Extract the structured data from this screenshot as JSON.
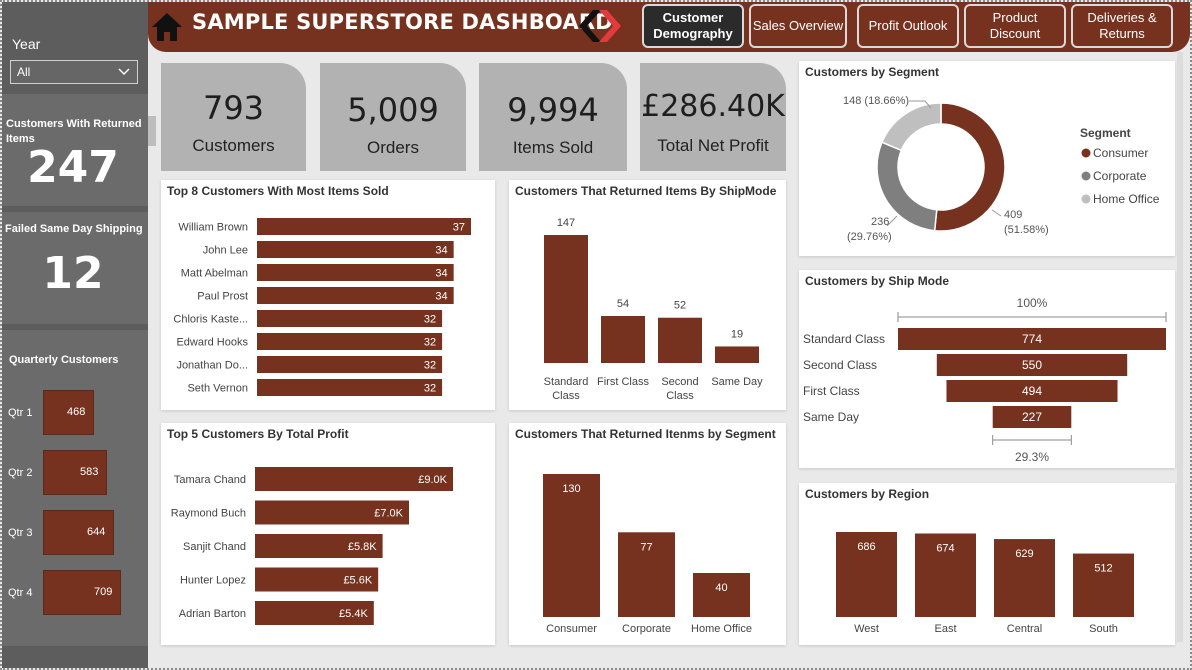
{
  "filters": {
    "year_label": "Year",
    "year_value": "All"
  },
  "side_kpis": {
    "returned_title": "Customers With Returned Items",
    "returned_value": "247",
    "failed_title": "Failed Same Day Shipping",
    "failed_value": "12"
  },
  "quarterly": {
    "title": "Quarterly Customers",
    "items": [
      {
        "label": "Qtr 1",
        "value": 468
      },
      {
        "label": "Qtr 2",
        "value": 583
      },
      {
        "label": "Qtr 3",
        "value": 644
      },
      {
        "label": "Qtr 4",
        "value": 709
      }
    ]
  },
  "header": {
    "title": "SAMPLE SUPERSTORE DASHBOARD",
    "nav": [
      {
        "label": "Customer Demography",
        "active": true
      },
      {
        "label": "Sales Overview",
        "active": false
      },
      {
        "label": "Profit Outlook",
        "active": false
      },
      {
        "label": "Product Discount",
        "active": false
      },
      {
        "label": "Deliveries & Returns",
        "active": false
      }
    ]
  },
  "kpis": [
    {
      "value": "793",
      "label": "Customers"
    },
    {
      "value": "5,009",
      "label": "Orders"
    },
    {
      "value": "9,994",
      "label": "Items Sold"
    },
    {
      "value": "£286.40K",
      "label": "Total Net Profit"
    }
  ],
  "colors": {
    "accent": "#76321f",
    "grey": "#b2b2b2",
    "sidebar": "#5d5d5d",
    "donut_corporate": "#7f7f7f",
    "donut_home": "#bfbfbf"
  },
  "chart_data": [
    {
      "id": "top8",
      "type": "bar",
      "orientation": "horizontal",
      "title": "Top 8 Customers With Most Items Sold",
      "categories": [
        "William Brown",
        "John Lee",
        "Matt Abelman",
        "Paul Prost",
        "Chloris Kaste...",
        "Edward Hooks",
        "Jonathan Do...",
        "Seth Vernon"
      ],
      "values": [
        37,
        34,
        34,
        34,
        32,
        32,
        32,
        32
      ]
    },
    {
      "id": "returned_shipmode",
      "type": "bar",
      "title": "Customers That Returned Items By ShipMode",
      "categories": [
        "Standard Class",
        "First Class",
        "Second Class",
        "Same Day"
      ],
      "values": [
        147,
        54,
        52,
        19
      ]
    },
    {
      "id": "top5_profit",
      "type": "bar",
      "orientation": "horizontal",
      "title": "Top 5 Customers By Total Profit",
      "categories": [
        "Tamara Chand",
        "Raymond Buch",
        "Sanjit Chand",
        "Hunter Lopez",
        "Adrian Barton"
      ],
      "values": [
        9.0,
        7.0,
        5.8,
        5.6,
        5.4
      ],
      "value_labels": [
        "£9.0K",
        "£7.0K",
        "£5.8K",
        "£5.6K",
        "£5.4K"
      ]
    },
    {
      "id": "returned_segment",
      "type": "bar",
      "title": "Customers That Returned Itenms by Segment",
      "categories": [
        "Consumer",
        "Corporate",
        "Home Office"
      ],
      "values": [
        130,
        77,
        40
      ]
    },
    {
      "id": "segment",
      "type": "pie",
      "title": "Customers by Segment",
      "legend_title": "Segment",
      "categories": [
        "Consumer",
        "Corporate",
        "Home Office"
      ],
      "values": [
        409,
        236,
        148
      ],
      "labels": [
        "409\n(51.58%)",
        "236\n(29.76%)",
        "148 (18.66%)"
      ]
    },
    {
      "id": "shipmode",
      "type": "bar",
      "subtype": "funnel",
      "title": "Customers by Ship Mode",
      "categories": [
        "Standard Class",
        "Second Class",
        "First Class",
        "Same Day"
      ],
      "values": [
        774,
        550,
        494,
        227
      ],
      "top_label": "100%",
      "bottom_label": "29.3%"
    },
    {
      "id": "region",
      "type": "bar",
      "title": "Customers by Region",
      "categories": [
        "West",
        "East",
        "Central",
        "South"
      ],
      "values": [
        686,
        674,
        629,
        512
      ]
    }
  ]
}
